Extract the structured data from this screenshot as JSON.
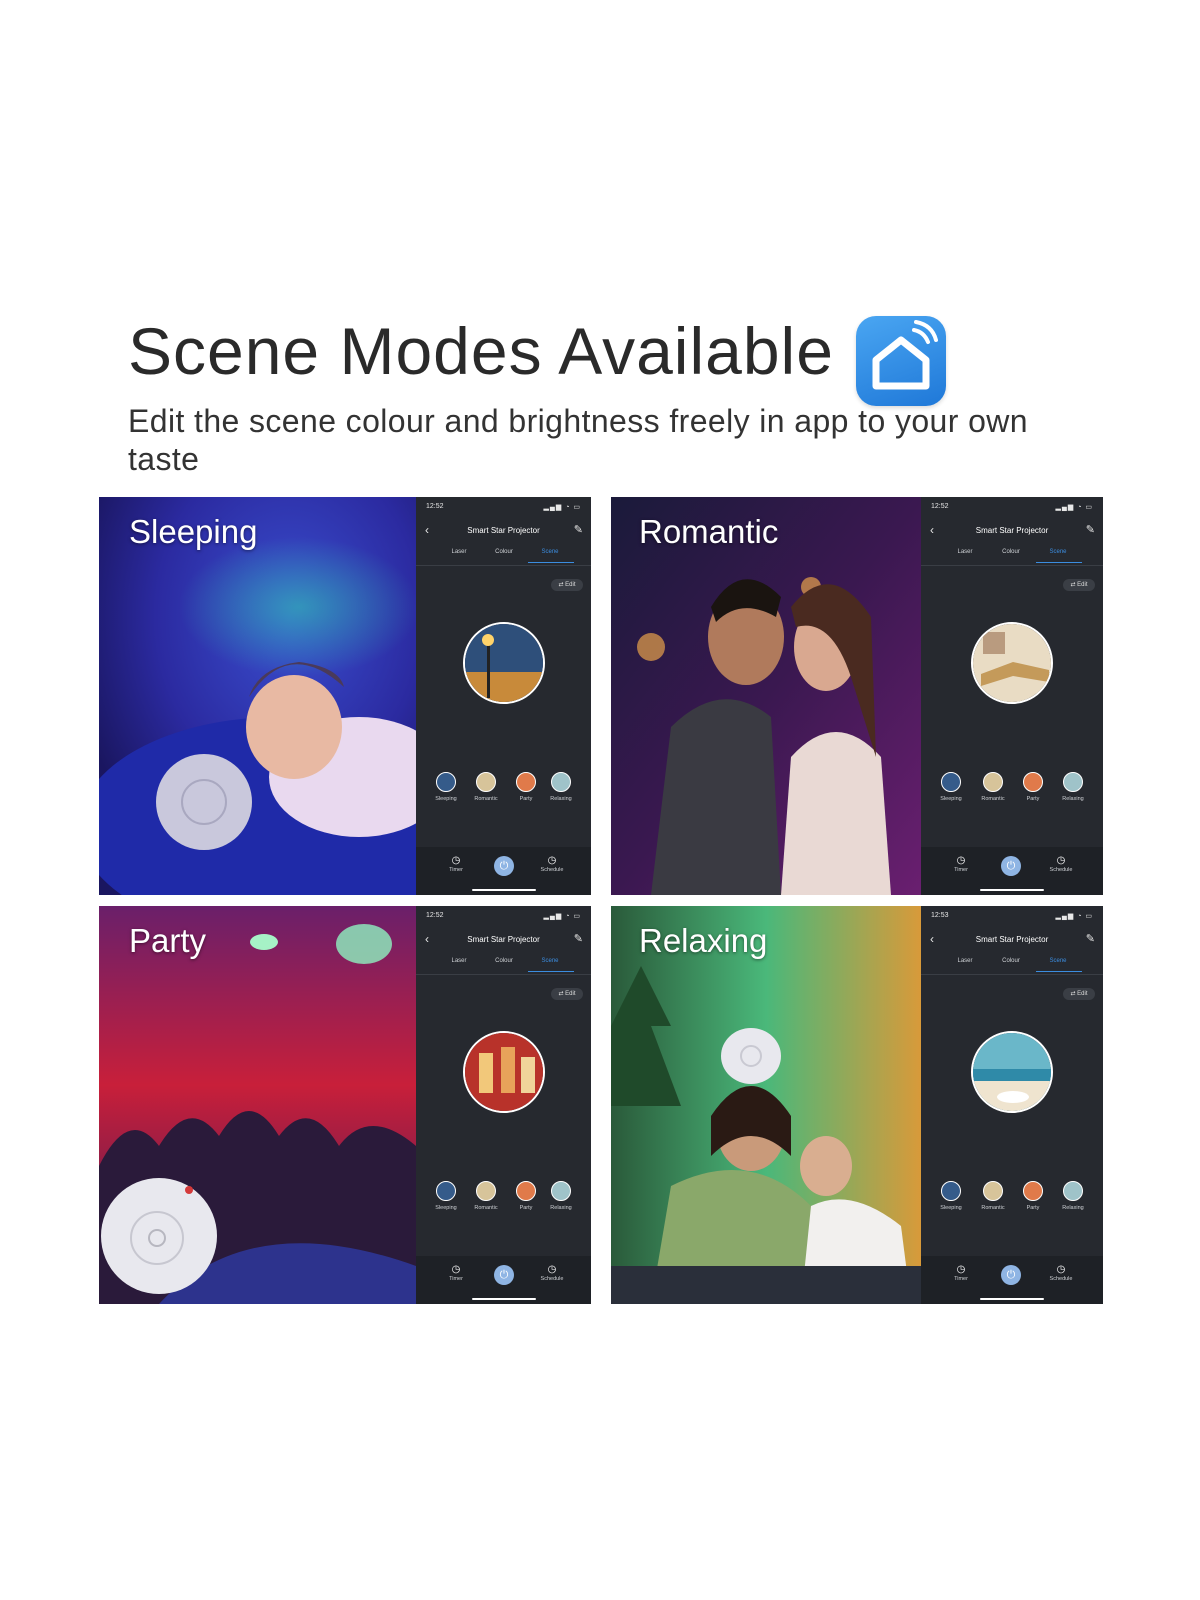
{
  "header": {
    "title": "Scene Modes Available",
    "subtitle": "Edit the scene colour and brightness freely in app to your own taste",
    "logo_icon": "smart-home-app-icon",
    "logo_color": "#2f8fe6"
  },
  "panels": [
    {
      "scene_name": "Sleeping",
      "phone": {
        "time": "12:52",
        "app_title": "Smart Star Projector",
        "tabs": [
          "Laser",
          "Colour",
          "Scene"
        ],
        "active_tab": "Scene",
        "edit_label": "Edit",
        "scenes": [
          "Sleeping",
          "Romantic",
          "Party",
          "Relaxing"
        ],
        "bottom": {
          "timer": "Timer",
          "schedule": "Schedule"
        }
      }
    },
    {
      "scene_name": "Romantic",
      "phone": {
        "time": "12:52",
        "app_title": "Smart Star Projector",
        "tabs": [
          "Laser",
          "Colour",
          "Scene"
        ],
        "active_tab": "Scene",
        "edit_label": "Edit",
        "scenes": [
          "Sleeping",
          "Romantic",
          "Party",
          "Relaxing"
        ],
        "bottom": {
          "timer": "Timer",
          "schedule": "Schedule"
        }
      }
    },
    {
      "scene_name": "Party",
      "phone": {
        "time": "12:52",
        "app_title": "Smart Star Projector",
        "tabs": [
          "Laser",
          "Colour",
          "Scene"
        ],
        "active_tab": "Scene",
        "edit_label": "Edit",
        "scenes": [
          "Sleeping",
          "Romantic",
          "Party",
          "Relaxing"
        ],
        "bottom": {
          "timer": "Timer",
          "schedule": "Schedule"
        }
      }
    },
    {
      "scene_name": "Relaxing",
      "phone": {
        "time": "12:53",
        "app_title": "Smart Star Projector",
        "tabs": [
          "Laser",
          "Colour",
          "Scene"
        ],
        "active_tab": "Scene",
        "edit_label": "Edit",
        "scenes": [
          "Sleeping",
          "Romantic",
          "Party",
          "Relaxing"
        ],
        "bottom": {
          "timer": "Timer",
          "schedule": "Schedule"
        }
      }
    }
  ],
  "colors": {
    "phone_bg": "#26292f",
    "accent_blue": "#3b8de0",
    "power_button": "#8fb5e4"
  }
}
